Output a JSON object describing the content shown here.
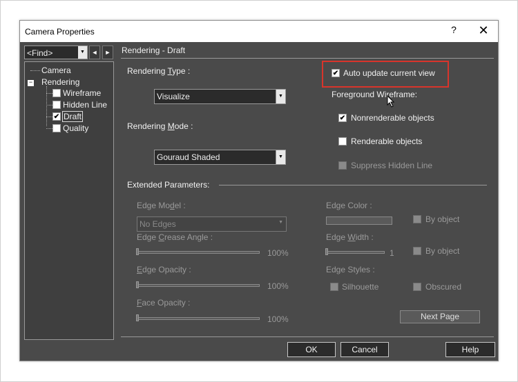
{
  "window": {
    "title": "Camera Properties",
    "help_label": "?",
    "close_label": "✕"
  },
  "find": {
    "value": "<Find>",
    "dropdown_arrow": "▼",
    "prev_arrow": "◄",
    "next_arrow": "►"
  },
  "tree": {
    "camera": "Camera",
    "rendering": "Rendering",
    "expander": "−",
    "items": [
      {
        "label": "Wireframe",
        "checked": false
      },
      {
        "label": "Hidden Line",
        "checked": false
      },
      {
        "label": "Draft",
        "checked": true
      },
      {
        "label": "Quality",
        "checked": false
      }
    ]
  },
  "panel": {
    "header": "Rendering - Draft"
  },
  "rendering_type": {
    "label_pre": "Rendering ",
    "label_key": "T",
    "label_post": "ype :",
    "value": "Visualize"
  },
  "rendering_mode": {
    "label_pre": "Rendering ",
    "label_key": "M",
    "label_post": "ode :",
    "value": "Gouraud Shaded"
  },
  "auto_update": {
    "label": "Auto update current view",
    "checked": true,
    "highlight_color": "#d9342b"
  },
  "foreground": {
    "label": "Foreground Wireframe:",
    "nonrenderable": "Nonrenderable objects",
    "renderable": "Renderable objects",
    "suppress": "Suppress Hidden Line"
  },
  "extended": {
    "label": "Extended Parameters:",
    "edge_model_pre": "Edge Mo",
    "edge_model_key": "d",
    "edge_model_post": "el :",
    "edge_model_value": "No Edges",
    "edge_crease_pre": "Edge ",
    "edge_crease_key": "C",
    "edge_crease_post": "rease Angle :",
    "edge_crease_value": "100%",
    "edge_opacity_pre": "",
    "edge_opacity_key": "E",
    "edge_opacity_post": "dge Opacity :",
    "edge_opacity_value": "100%",
    "face_opacity_pre": "",
    "face_opacity_key": "F",
    "face_opacity_post": "ace Opacity :",
    "face_opacity_value": "100%",
    "edge_color": "Edge Color :",
    "edge_color_byobject": "By object",
    "edge_width_pre": "Edge ",
    "edge_width_key": "W",
    "edge_width_post": "idth :",
    "edge_width_value": "1",
    "edge_width_byobject": "By object",
    "edge_styles": "Edge Styles :",
    "silhouette": "Silhouette",
    "obscured": "Obscured",
    "next_page": "Next Page"
  },
  "buttons": {
    "ok": "OK",
    "cancel": "Cancel",
    "help": "Help"
  },
  "icons": {
    "check": "✔",
    "cursor": "mouse-pointer-icon"
  }
}
